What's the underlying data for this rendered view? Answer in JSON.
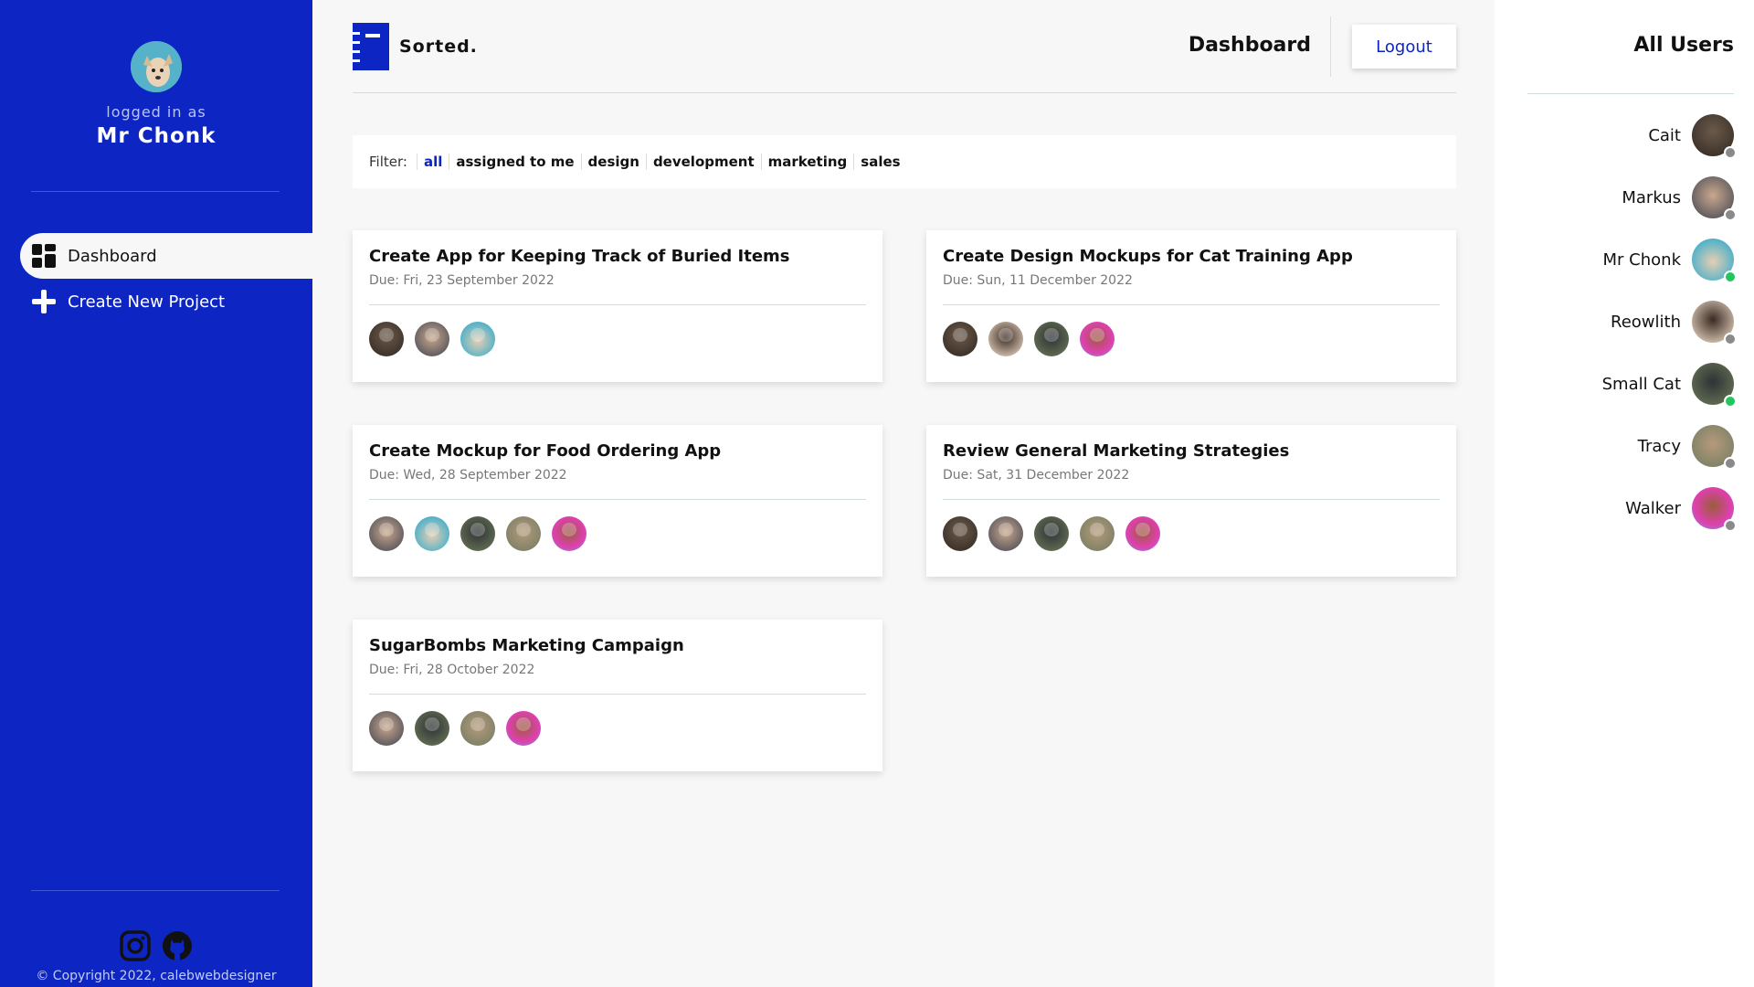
{
  "sidebar": {
    "logged_in_label": "logged in as",
    "username": "Mr Chonk",
    "nav": [
      {
        "label": "Dashboard",
        "icon": "dashboard-grid-icon"
      },
      {
        "label": "Create New Project",
        "icon": "plus-icon"
      }
    ],
    "social_icons": [
      "instagram-icon",
      "github-icon"
    ],
    "copyright": "© Copyright 2022, calebwebdesigner"
  },
  "header": {
    "logo_text": "Sorted.",
    "page_title": "Dashboard",
    "logout_label": "Logout"
  },
  "filter": {
    "label": "Filter:",
    "options": [
      "all",
      "assigned to me",
      "design",
      "development",
      "marketing",
      "sales"
    ],
    "active": "all"
  },
  "projects": [
    {
      "title": "Create App for Keeping Track of Buried Items",
      "due": "Due: Fri, 23 September 2022"
    },
    {
      "title": "Create Design Mockups for Cat Training App",
      "due": "Due: Sun, 11 December 2022"
    },
    {
      "title": "Create Mockup for Food Ordering App",
      "due": "Due: Wed, 28 September 2022"
    },
    {
      "title": "Review General Marketing Strategies",
      "due": "Due: Sat, 31 December 2022"
    },
    {
      "title": "SugarBombs Marketing Campaign",
      "due": "Due: Fri, 28 October 2022"
    }
  ],
  "users_panel": {
    "title": "All Users",
    "users": [
      {
        "name": "Cait",
        "online": false
      },
      {
        "name": "Markus",
        "online": false
      },
      {
        "name": "Mr Chonk",
        "online": true
      },
      {
        "name": "Reowlith",
        "online": false
      },
      {
        "name": "Small Cat",
        "online": true
      },
      {
        "name": "Tracy",
        "online": false
      },
      {
        "name": "Walker",
        "online": false
      }
    ]
  },
  "colors": {
    "brand_blue": "#0d25c2",
    "online": "#22c55e",
    "offline": "#8a8a8a"
  }
}
